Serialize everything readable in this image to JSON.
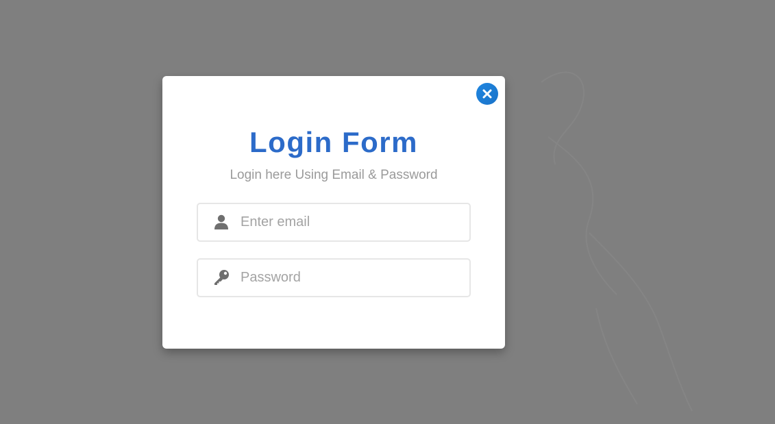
{
  "login_modal": {
    "title": "Login Form",
    "subtitle": "Login here Using Email & Password",
    "close_icon": "close-icon",
    "email_field": {
      "icon": "user-icon",
      "placeholder": "Enter email",
      "value": ""
    },
    "password_field": {
      "icon": "key-icon",
      "placeholder": "Password",
      "value": ""
    }
  },
  "colors": {
    "overlay": "#7f7f7f",
    "title": "#2c6bc9",
    "close_button": "#1f86e0",
    "subtitle": "#9a9a9a",
    "icon": "#6f6f6f"
  }
}
